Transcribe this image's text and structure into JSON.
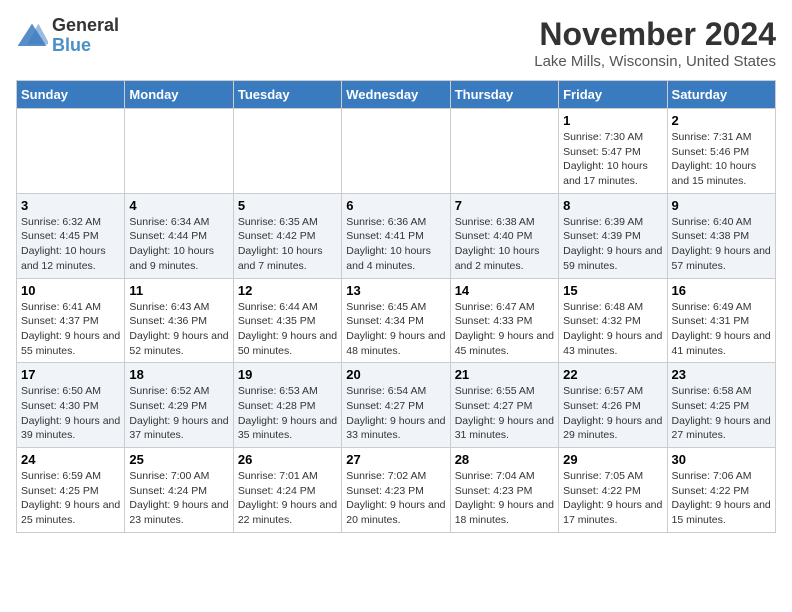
{
  "logo": {
    "general": "General",
    "blue": "Blue"
  },
  "header": {
    "title": "November 2024",
    "subtitle": "Lake Mills, Wisconsin, United States"
  },
  "days_of_week": [
    "Sunday",
    "Monday",
    "Tuesday",
    "Wednesday",
    "Thursday",
    "Friday",
    "Saturday"
  ],
  "weeks": [
    [
      {
        "day": "",
        "info": ""
      },
      {
        "day": "",
        "info": ""
      },
      {
        "day": "",
        "info": ""
      },
      {
        "day": "",
        "info": ""
      },
      {
        "day": "",
        "info": ""
      },
      {
        "day": "1",
        "info": "Sunrise: 7:30 AM\nSunset: 5:47 PM\nDaylight: 10 hours and 17 minutes."
      },
      {
        "day": "2",
        "info": "Sunrise: 7:31 AM\nSunset: 5:46 PM\nDaylight: 10 hours and 15 minutes."
      }
    ],
    [
      {
        "day": "3",
        "info": "Sunrise: 6:32 AM\nSunset: 4:45 PM\nDaylight: 10 hours and 12 minutes."
      },
      {
        "day": "4",
        "info": "Sunrise: 6:34 AM\nSunset: 4:44 PM\nDaylight: 10 hours and 9 minutes."
      },
      {
        "day": "5",
        "info": "Sunrise: 6:35 AM\nSunset: 4:42 PM\nDaylight: 10 hours and 7 minutes."
      },
      {
        "day": "6",
        "info": "Sunrise: 6:36 AM\nSunset: 4:41 PM\nDaylight: 10 hours and 4 minutes."
      },
      {
        "day": "7",
        "info": "Sunrise: 6:38 AM\nSunset: 4:40 PM\nDaylight: 10 hours and 2 minutes."
      },
      {
        "day": "8",
        "info": "Sunrise: 6:39 AM\nSunset: 4:39 PM\nDaylight: 9 hours and 59 minutes."
      },
      {
        "day": "9",
        "info": "Sunrise: 6:40 AM\nSunset: 4:38 PM\nDaylight: 9 hours and 57 minutes."
      }
    ],
    [
      {
        "day": "10",
        "info": "Sunrise: 6:41 AM\nSunset: 4:37 PM\nDaylight: 9 hours and 55 minutes."
      },
      {
        "day": "11",
        "info": "Sunrise: 6:43 AM\nSunset: 4:36 PM\nDaylight: 9 hours and 52 minutes."
      },
      {
        "day": "12",
        "info": "Sunrise: 6:44 AM\nSunset: 4:35 PM\nDaylight: 9 hours and 50 minutes."
      },
      {
        "day": "13",
        "info": "Sunrise: 6:45 AM\nSunset: 4:34 PM\nDaylight: 9 hours and 48 minutes."
      },
      {
        "day": "14",
        "info": "Sunrise: 6:47 AM\nSunset: 4:33 PM\nDaylight: 9 hours and 45 minutes."
      },
      {
        "day": "15",
        "info": "Sunrise: 6:48 AM\nSunset: 4:32 PM\nDaylight: 9 hours and 43 minutes."
      },
      {
        "day": "16",
        "info": "Sunrise: 6:49 AM\nSunset: 4:31 PM\nDaylight: 9 hours and 41 minutes."
      }
    ],
    [
      {
        "day": "17",
        "info": "Sunrise: 6:50 AM\nSunset: 4:30 PM\nDaylight: 9 hours and 39 minutes."
      },
      {
        "day": "18",
        "info": "Sunrise: 6:52 AM\nSunset: 4:29 PM\nDaylight: 9 hours and 37 minutes."
      },
      {
        "day": "19",
        "info": "Sunrise: 6:53 AM\nSunset: 4:28 PM\nDaylight: 9 hours and 35 minutes."
      },
      {
        "day": "20",
        "info": "Sunrise: 6:54 AM\nSunset: 4:27 PM\nDaylight: 9 hours and 33 minutes."
      },
      {
        "day": "21",
        "info": "Sunrise: 6:55 AM\nSunset: 4:27 PM\nDaylight: 9 hours and 31 minutes."
      },
      {
        "day": "22",
        "info": "Sunrise: 6:57 AM\nSunset: 4:26 PM\nDaylight: 9 hours and 29 minutes."
      },
      {
        "day": "23",
        "info": "Sunrise: 6:58 AM\nSunset: 4:25 PM\nDaylight: 9 hours and 27 minutes."
      }
    ],
    [
      {
        "day": "24",
        "info": "Sunrise: 6:59 AM\nSunset: 4:25 PM\nDaylight: 9 hours and 25 minutes."
      },
      {
        "day": "25",
        "info": "Sunrise: 7:00 AM\nSunset: 4:24 PM\nDaylight: 9 hours and 23 minutes."
      },
      {
        "day": "26",
        "info": "Sunrise: 7:01 AM\nSunset: 4:24 PM\nDaylight: 9 hours and 22 minutes."
      },
      {
        "day": "27",
        "info": "Sunrise: 7:02 AM\nSunset: 4:23 PM\nDaylight: 9 hours and 20 minutes."
      },
      {
        "day": "28",
        "info": "Sunrise: 7:04 AM\nSunset: 4:23 PM\nDaylight: 9 hours and 18 minutes."
      },
      {
        "day": "29",
        "info": "Sunrise: 7:05 AM\nSunset: 4:22 PM\nDaylight: 9 hours and 17 minutes."
      },
      {
        "day": "30",
        "info": "Sunrise: 7:06 AM\nSunset: 4:22 PM\nDaylight: 9 hours and 15 minutes."
      }
    ]
  ]
}
